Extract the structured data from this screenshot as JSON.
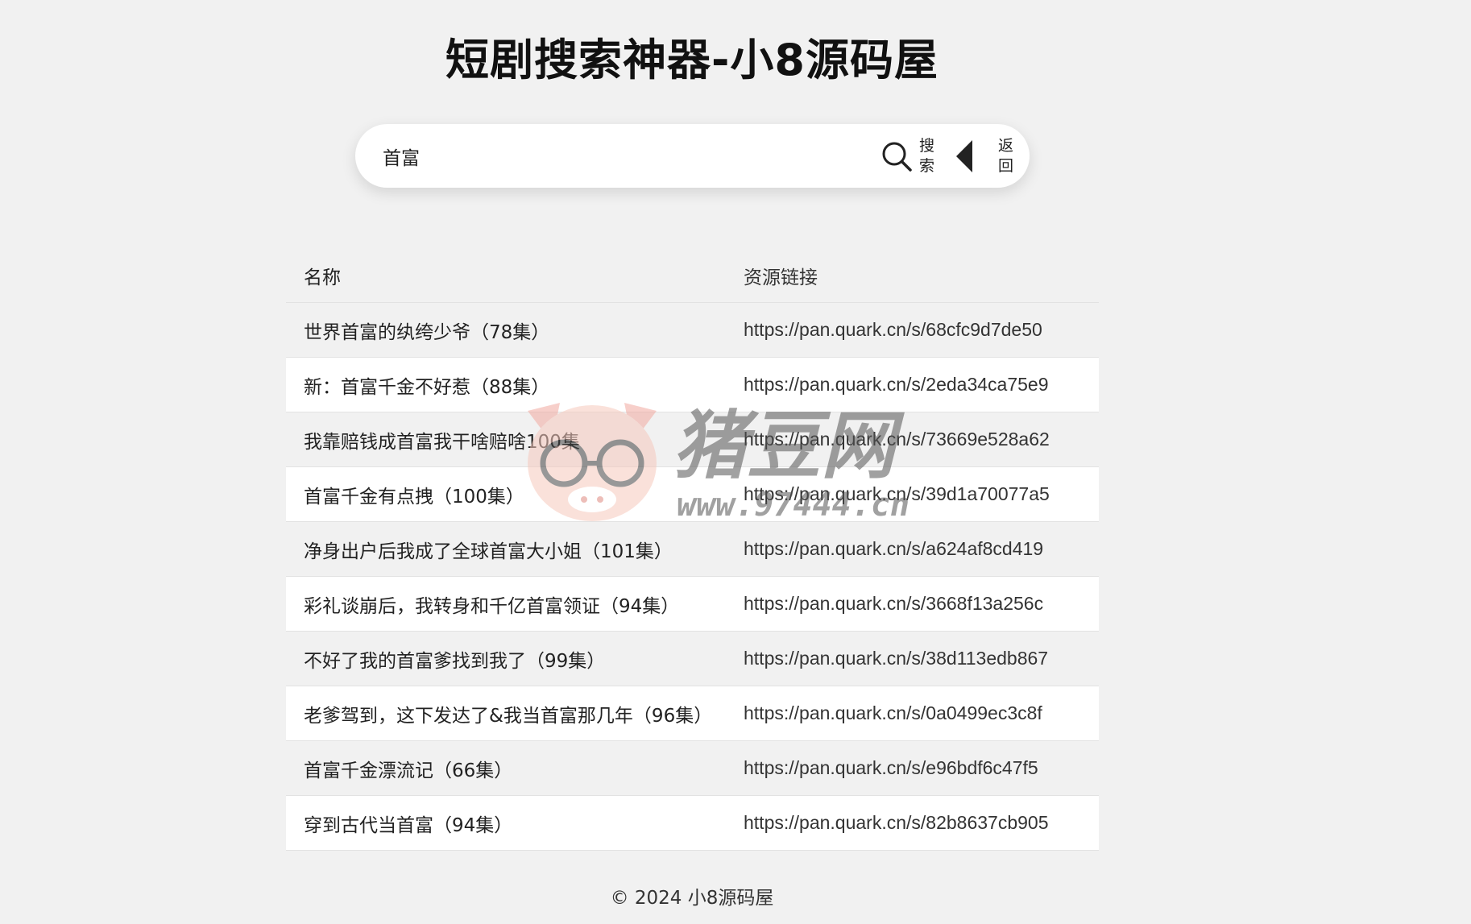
{
  "page": {
    "title": "短剧搜索神器-小8源码屋",
    "footer": "© 2024 小8源码屋"
  },
  "search": {
    "value": "首富",
    "search_label": "搜索",
    "back_label": "返回"
  },
  "table": {
    "headers": {
      "name": "名称",
      "link": "资源链接"
    },
    "rows": [
      {
        "name": "世界首富的纨绔少爷（78集）",
        "link": "https://pan.quark.cn/s/68cfc9d7de50"
      },
      {
        "name": "新：首富千金不好惹（88集）",
        "link": "https://pan.quark.cn/s/2eda34ca75e9"
      },
      {
        "name": "我靠赔钱成首富我干啥赔啥100集",
        "link": "https://pan.quark.cn/s/73669e528a62"
      },
      {
        "name": "首富千金有点拽（100集）",
        "link": "https://pan.quark.cn/s/39d1a70077a5"
      },
      {
        "name": "净身出户后我成了全球首富大小姐（101集）",
        "link": "https://pan.quark.cn/s/a624af8cd419"
      },
      {
        "name": "彩礼谈崩后，我转身和千亿首富领证（94集）",
        "link": "https://pan.quark.cn/s/3668f13a256c"
      },
      {
        "name": "不好了我的首富爹找到我了（99集）",
        "link": "https://pan.quark.cn/s/38d113edb867"
      },
      {
        "name": "老爹驾到，这下发达了&我当首富那几年（96集）",
        "link": "https://pan.quark.cn/s/0a0499ec3c8f"
      },
      {
        "name": "首富千金漂流记（66集）",
        "link": "https://pan.quark.cn/s/e96bdf6c47f5"
      },
      {
        "name": "穿到古代当首富（94集）",
        "link": "https://pan.quark.cn/s/82b8637cb905"
      }
    ]
  },
  "watermark": {
    "brand": "猪豆网",
    "url": "www.97444.cn"
  },
  "colors": {
    "background": "#f1f1f1",
    "row_alt": "#ffffff",
    "text": "#222222"
  },
  "icons": {
    "search": "search-icon",
    "back": "back-triangle-icon"
  }
}
